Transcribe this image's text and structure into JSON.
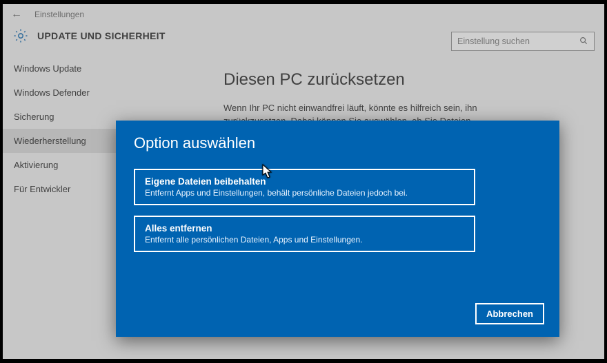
{
  "header": {
    "app_title": "Einstellungen",
    "section_title": "UPDATE UND SICHERHEIT",
    "search_placeholder": "Einstellung suchen"
  },
  "sidebar": {
    "items": [
      {
        "label": "Windows Update",
        "selected": false
      },
      {
        "label": "Windows Defender",
        "selected": false
      },
      {
        "label": "Sicherung",
        "selected": false
      },
      {
        "label": "Wiederherstellung",
        "selected": true
      },
      {
        "label": "Aktivierung",
        "selected": false
      },
      {
        "label": "Für Entwickler",
        "selected": false
      }
    ]
  },
  "main": {
    "heading": "Diesen PC zurücksetzen",
    "description": "Wenn Ihr PC nicht einwandfrei läuft, könnte es hilfreich sein, ihn zurückzusetzen. Dabei können Sie auswählen, ob Sie Dateien"
  },
  "modal": {
    "title": "Option auswählen",
    "options": [
      {
        "title": "Eigene Dateien beibehalten",
        "desc": "Entfernt Apps und Einstellungen, behält persönliche Dateien jedoch bei."
      },
      {
        "title": "Alles entfernen",
        "desc": "Entfernt alle persönlichen Dateien, Apps und Einstellungen."
      }
    ],
    "cancel_label": "Abbrechen"
  }
}
